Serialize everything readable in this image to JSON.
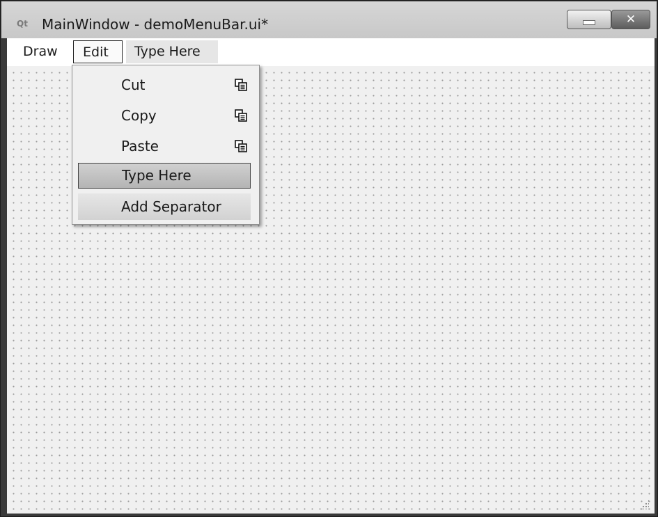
{
  "window": {
    "title": "MainWindow - demoMenuBar.ui*",
    "app_icon": "qt-logo-icon",
    "app_icon_text": "Qt",
    "minimize_icon": "minimize-icon",
    "close_icon": "close-icon",
    "close_glyph": "✕"
  },
  "menubar": {
    "items": [
      {
        "label": "Draw"
      },
      {
        "label": "Edit"
      },
      {
        "label": "Type Here"
      }
    ]
  },
  "edit_menu": {
    "items": [
      {
        "label": "Cut",
        "icon": "submenu-icon"
      },
      {
        "label": "Copy",
        "icon": "submenu-icon"
      },
      {
        "label": "Paste",
        "icon": "submenu-icon"
      },
      {
        "label": "Type Here"
      },
      {
        "label": "Add Separator"
      }
    ]
  },
  "colors": {
    "canvas_bg": "#f0f0f0",
    "grid_dot": "#9a9a9a",
    "selected_item": "#c4c4c4",
    "menubar_bg": "#ffffff"
  }
}
